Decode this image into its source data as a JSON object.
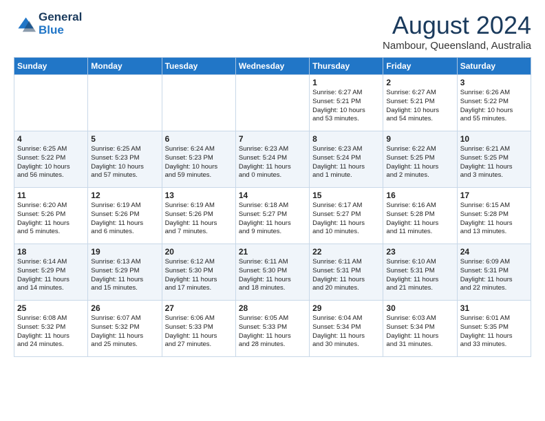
{
  "logo": {
    "line1": "General",
    "line2": "Blue"
  },
  "title": {
    "month_year": "August 2024",
    "location": "Nambour, Queensland, Australia"
  },
  "weekdays": [
    "Sunday",
    "Monday",
    "Tuesday",
    "Wednesday",
    "Thursday",
    "Friday",
    "Saturday"
  ],
  "weeks": [
    [
      {
        "day": "",
        "info": ""
      },
      {
        "day": "",
        "info": ""
      },
      {
        "day": "",
        "info": ""
      },
      {
        "day": "",
        "info": ""
      },
      {
        "day": "1",
        "info": "Sunrise: 6:27 AM\nSunset: 5:21 PM\nDaylight: 10 hours\nand 53 minutes."
      },
      {
        "day": "2",
        "info": "Sunrise: 6:27 AM\nSunset: 5:21 PM\nDaylight: 10 hours\nand 54 minutes."
      },
      {
        "day": "3",
        "info": "Sunrise: 6:26 AM\nSunset: 5:22 PM\nDaylight: 10 hours\nand 55 minutes."
      }
    ],
    [
      {
        "day": "4",
        "info": "Sunrise: 6:25 AM\nSunset: 5:22 PM\nDaylight: 10 hours\nand 56 minutes."
      },
      {
        "day": "5",
        "info": "Sunrise: 6:25 AM\nSunset: 5:23 PM\nDaylight: 10 hours\nand 57 minutes."
      },
      {
        "day": "6",
        "info": "Sunrise: 6:24 AM\nSunset: 5:23 PM\nDaylight: 10 hours\nand 59 minutes."
      },
      {
        "day": "7",
        "info": "Sunrise: 6:23 AM\nSunset: 5:24 PM\nDaylight: 11 hours\nand 0 minutes."
      },
      {
        "day": "8",
        "info": "Sunrise: 6:23 AM\nSunset: 5:24 PM\nDaylight: 11 hours\nand 1 minute."
      },
      {
        "day": "9",
        "info": "Sunrise: 6:22 AM\nSunset: 5:25 PM\nDaylight: 11 hours\nand 2 minutes."
      },
      {
        "day": "10",
        "info": "Sunrise: 6:21 AM\nSunset: 5:25 PM\nDaylight: 11 hours\nand 3 minutes."
      }
    ],
    [
      {
        "day": "11",
        "info": "Sunrise: 6:20 AM\nSunset: 5:26 PM\nDaylight: 11 hours\nand 5 minutes."
      },
      {
        "day": "12",
        "info": "Sunrise: 6:19 AM\nSunset: 5:26 PM\nDaylight: 11 hours\nand 6 minutes."
      },
      {
        "day": "13",
        "info": "Sunrise: 6:19 AM\nSunset: 5:26 PM\nDaylight: 11 hours\nand 7 minutes."
      },
      {
        "day": "14",
        "info": "Sunrise: 6:18 AM\nSunset: 5:27 PM\nDaylight: 11 hours\nand 9 minutes."
      },
      {
        "day": "15",
        "info": "Sunrise: 6:17 AM\nSunset: 5:27 PM\nDaylight: 11 hours\nand 10 minutes."
      },
      {
        "day": "16",
        "info": "Sunrise: 6:16 AM\nSunset: 5:28 PM\nDaylight: 11 hours\nand 11 minutes."
      },
      {
        "day": "17",
        "info": "Sunrise: 6:15 AM\nSunset: 5:28 PM\nDaylight: 11 hours\nand 13 minutes."
      }
    ],
    [
      {
        "day": "18",
        "info": "Sunrise: 6:14 AM\nSunset: 5:29 PM\nDaylight: 11 hours\nand 14 minutes."
      },
      {
        "day": "19",
        "info": "Sunrise: 6:13 AM\nSunset: 5:29 PM\nDaylight: 11 hours\nand 15 minutes."
      },
      {
        "day": "20",
        "info": "Sunrise: 6:12 AM\nSunset: 5:30 PM\nDaylight: 11 hours\nand 17 minutes."
      },
      {
        "day": "21",
        "info": "Sunrise: 6:11 AM\nSunset: 5:30 PM\nDaylight: 11 hours\nand 18 minutes."
      },
      {
        "day": "22",
        "info": "Sunrise: 6:11 AM\nSunset: 5:31 PM\nDaylight: 11 hours\nand 20 minutes."
      },
      {
        "day": "23",
        "info": "Sunrise: 6:10 AM\nSunset: 5:31 PM\nDaylight: 11 hours\nand 21 minutes."
      },
      {
        "day": "24",
        "info": "Sunrise: 6:09 AM\nSunset: 5:31 PM\nDaylight: 11 hours\nand 22 minutes."
      }
    ],
    [
      {
        "day": "25",
        "info": "Sunrise: 6:08 AM\nSunset: 5:32 PM\nDaylight: 11 hours\nand 24 minutes."
      },
      {
        "day": "26",
        "info": "Sunrise: 6:07 AM\nSunset: 5:32 PM\nDaylight: 11 hours\nand 25 minutes."
      },
      {
        "day": "27",
        "info": "Sunrise: 6:06 AM\nSunset: 5:33 PM\nDaylight: 11 hours\nand 27 minutes."
      },
      {
        "day": "28",
        "info": "Sunrise: 6:05 AM\nSunset: 5:33 PM\nDaylight: 11 hours\nand 28 minutes."
      },
      {
        "day": "29",
        "info": "Sunrise: 6:04 AM\nSunset: 5:34 PM\nDaylight: 11 hours\nand 30 minutes."
      },
      {
        "day": "30",
        "info": "Sunrise: 6:03 AM\nSunset: 5:34 PM\nDaylight: 11 hours\nand 31 minutes."
      },
      {
        "day": "31",
        "info": "Sunrise: 6:01 AM\nSunset: 5:35 PM\nDaylight: 11 hours\nand 33 minutes."
      }
    ]
  ]
}
